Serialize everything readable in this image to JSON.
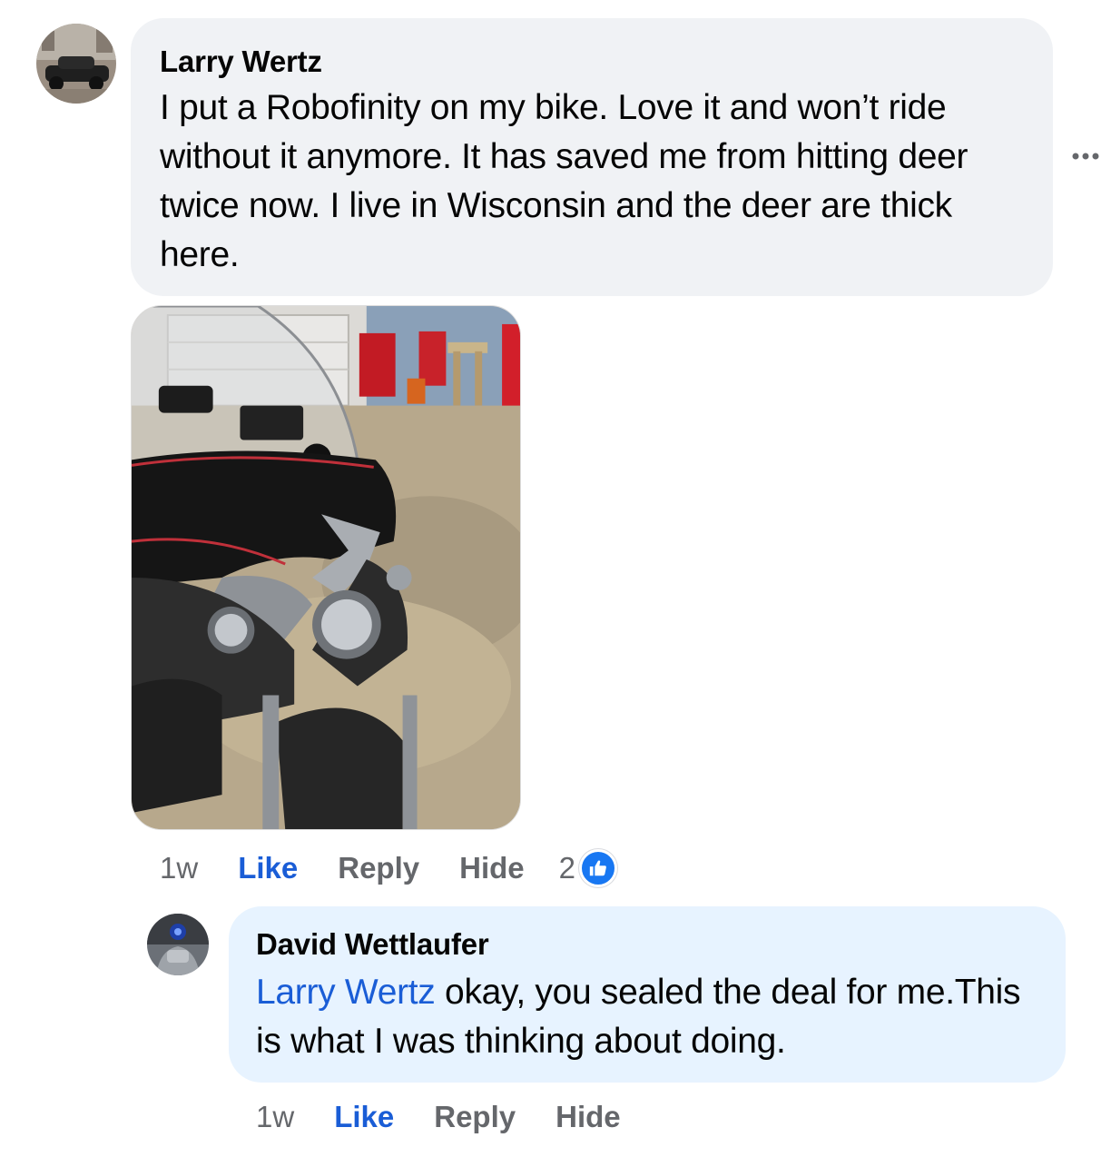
{
  "comments": [
    {
      "author": "Larry Wertz",
      "text_lines": [
        "I put a Robofinity on my bike. Love it and won’t ride",
        "without it anymore. It has saved me from hitting deer",
        "twice now. I live in Wisconsin and the deer are thick",
        "here."
      ],
      "has_photo": true,
      "actions": {
        "time": "1w",
        "like": "Like",
        "reply": "Reply",
        "hide": "Hide",
        "reaction_count": "2"
      }
    },
    {
      "author": "David Wettlaufer",
      "mention": "Larry Wertz",
      "text_first_line_rest": " okay, you sealed the deal for me.This",
      "text_second_line": "is what I was thinking about doing.",
      "actions": {
        "time": "1w",
        "like": "Like",
        "reply": "Reply",
        "hide": "Hide"
      }
    }
  ],
  "icons": {
    "more_options": "more-horizontal-icon",
    "reaction": "thumbs-up-icon"
  },
  "colors": {
    "bubble_primary": "#f0f2f5",
    "bubble_reply": "#e7f3ff",
    "link_blue": "#1a5dd6",
    "meta_gray": "#65676b",
    "like_badge": "#1877f2"
  }
}
